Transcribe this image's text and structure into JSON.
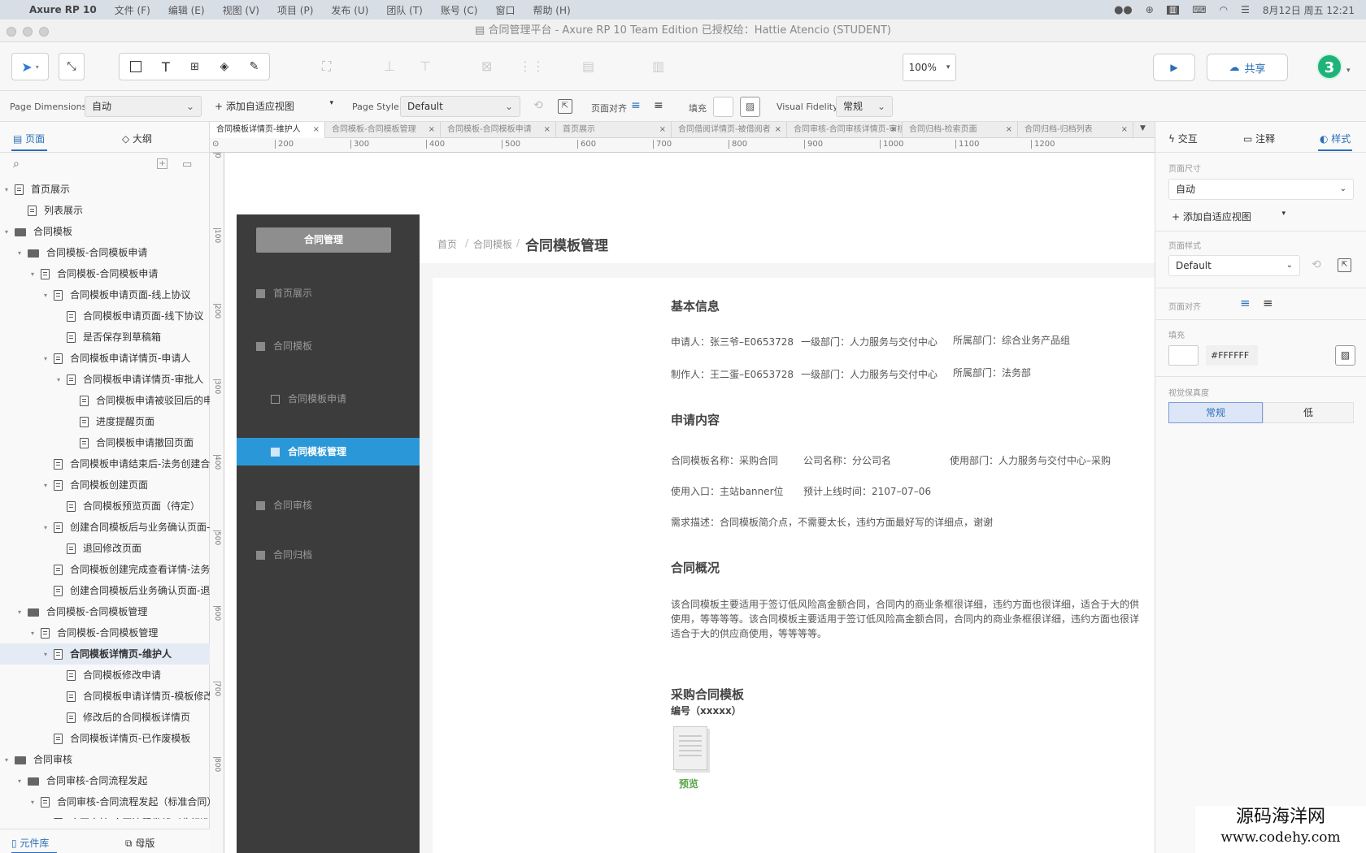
{
  "menubar": {
    "items": [
      "Axure RP 10",
      "文件 (F)",
      "编辑 (E)",
      "视图 (V)",
      "项目 (P)",
      "发布 (U)",
      "团队 (T)",
      "账号 (C)",
      "窗口",
      "帮助 (H)"
    ],
    "datetime": "8月12日 周五  12:21"
  },
  "window": {
    "title": "合同管理平台 - Axure RP 10 Team Edition  已授权给：Hattie Atencio (STUDENT)"
  },
  "toolbar": {
    "zoom": "100%",
    "share_label": "共享",
    "user_avatar": "3"
  },
  "props": {
    "page_dimensions_label": "Page Dimensions",
    "page_dimensions_value": "自动",
    "add_adaptive_label": "+ 添加自适应视图",
    "page_style_label": "Page Style",
    "page_style_value": "Default",
    "align_label": "页面对齐",
    "fill_label": "填充",
    "visual_fidelity_label": "Visual Fidelity",
    "visual_fidelity_value": "常规"
  },
  "left_panel": {
    "tab_pages": "页面",
    "tab_outline": "大纲",
    "bottom_library": "元件库",
    "bottom_masters": "母版",
    "tree": [
      {
        "label": "首页展示",
        "indent": 0,
        "type": "page",
        "arrow": "▾"
      },
      {
        "label": "列表展示",
        "indent": 1,
        "type": "page",
        "arrow": ""
      },
      {
        "label": "合同模板",
        "indent": 0,
        "type": "folder",
        "arrow": "▾"
      },
      {
        "label": "合同模板-合同模板申请",
        "indent": 1,
        "type": "folder",
        "arrow": "▾"
      },
      {
        "label": "合同模板-合同模板申请",
        "indent": 2,
        "type": "page",
        "arrow": "▾"
      },
      {
        "label": "合同模板申请页面-线上协议",
        "indent": 3,
        "type": "page",
        "arrow": "▾"
      },
      {
        "label": "合同模板申请页面-线下协议",
        "indent": 4,
        "type": "page",
        "arrow": ""
      },
      {
        "label": "是否保存到草稿箱",
        "indent": 4,
        "type": "page",
        "arrow": ""
      },
      {
        "label": "合同模板申请详情页-申请人",
        "indent": 3,
        "type": "page",
        "arrow": "▾"
      },
      {
        "label": "合同模板申请详情页-审批人",
        "indent": 4,
        "type": "page",
        "arrow": "▾"
      },
      {
        "label": "合同模板申请被驳回后的申",
        "indent": 5,
        "type": "page",
        "arrow": ""
      },
      {
        "label": "进度提醒页面",
        "indent": 5,
        "type": "page",
        "arrow": ""
      },
      {
        "label": "合同模板申请撤回页面",
        "indent": 5,
        "type": "page",
        "arrow": ""
      },
      {
        "label": "合同模板申请结束后-法务创建合同",
        "indent": 3,
        "type": "page",
        "arrow": ""
      },
      {
        "label": "合同模板创建页面",
        "indent": 3,
        "type": "page",
        "arrow": "▾"
      },
      {
        "label": "合同模板预览页面（待定）",
        "indent": 4,
        "type": "page",
        "arrow": ""
      },
      {
        "label": "创建合同模板后与业务确认页面-业",
        "indent": 3,
        "type": "page",
        "arrow": "▾"
      },
      {
        "label": "退回修改页面",
        "indent": 4,
        "type": "page",
        "arrow": ""
      },
      {
        "label": "合同模板创建完成查看详情-法务人",
        "indent": 3,
        "type": "page",
        "arrow": ""
      },
      {
        "label": "创建合同模板后业务确认页面-退回",
        "indent": 3,
        "type": "page",
        "arrow": ""
      },
      {
        "label": "合同模板-合同模板管理",
        "indent": 1,
        "type": "folder",
        "arrow": "▾"
      },
      {
        "label": "合同模板-合同模板管理",
        "indent": 2,
        "type": "page",
        "arrow": "▾"
      },
      {
        "label": "合同模板详情页-维护人",
        "indent": 3,
        "type": "page",
        "arrow": "▾",
        "selected": true
      },
      {
        "label": "合同模板修改申请",
        "indent": 4,
        "type": "page",
        "arrow": ""
      },
      {
        "label": "合同模板申请详情页-模板修改",
        "indent": 4,
        "type": "page",
        "arrow": ""
      },
      {
        "label": "修改后的合同模板详情页",
        "indent": 4,
        "type": "page",
        "arrow": ""
      },
      {
        "label": "合同模板详情页-已作废模板",
        "indent": 3,
        "type": "page",
        "arrow": ""
      },
      {
        "label": "合同审核",
        "indent": 0,
        "type": "folder",
        "arrow": "▾"
      },
      {
        "label": "合同审核-合同流程发起",
        "indent": 1,
        "type": "folder",
        "arrow": "▾"
      },
      {
        "label": "合同审核-合同流程发起（标准合同）",
        "indent": 2,
        "type": "page",
        "arrow": "▾"
      },
      {
        "label": "合同审核-合同流程发起（非标准",
        "indent": 3,
        "type": "page",
        "arrow": ""
      }
    ]
  },
  "doc_tabs": [
    {
      "label": "合同模板详情页-维护人",
      "active": true
    },
    {
      "label": "合同模板-合同模板管理",
      "active": false
    },
    {
      "label": "合同模板-合同模板申请",
      "active": false
    },
    {
      "label": "首页展示",
      "active": false
    },
    {
      "label": "合同借阅详情页-被借阅者",
      "active": false
    },
    {
      "label": "合同审核-合同审核详情页-审核人",
      "active": false
    },
    {
      "label": "合同归档-检索页面",
      "active": false
    },
    {
      "label": "合同归档-归档列表",
      "active": false
    }
  ],
  "ruler_h": [
    "200",
    "300",
    "400",
    "500",
    "600",
    "700",
    "800",
    "900",
    "1000",
    "1100",
    "1200"
  ],
  "ruler_v": [
    "0",
    "100",
    "200",
    "300",
    "400",
    "500",
    "600",
    "700",
    "800"
  ],
  "prototype": {
    "top_button": "合同管理",
    "side_items": [
      {
        "label": "首页展示",
        "sub": false,
        "active": false
      },
      {
        "label": "合同模板",
        "sub": false,
        "active": false
      },
      {
        "label": "合同模板申请",
        "sub": true,
        "active": false
      },
      {
        "label": "合同模板管理",
        "sub": true,
        "active": true
      },
      {
        "label": "合同审核",
        "sub": false,
        "active": false
      },
      {
        "label": "合同归档",
        "sub": false,
        "active": false
      }
    ],
    "breadcrumb": {
      "home": "首页",
      "parent": "合同模板",
      "sep": "/",
      "current": "合同模板管理"
    },
    "basic_title": "基本信息",
    "applicant": "申请人：张三爷–E0653728",
    "dept1": "一级部门：人力服务与交付中心",
    "owner_dept1": "所属部门：综合业务产品组",
    "maker": "制作人：王二蛋–E0653728",
    "dept2": "一级部门：人力服务与交付中心",
    "owner_dept2": "所属部门：法务部",
    "apply_title": "申请内容",
    "tpl_name": "合同模板名称：采购合同",
    "company": "公司名称：分公司名",
    "use_dept": "使用部门：人力服务与交付中心–采购",
    "entry": "使用入口：主站banner位",
    "launch": "预计上线时间：2107–07–06",
    "desc": "需求描述：合同模板简介点，不需要太长，违约方面最好写的详细点，谢谢",
    "overview_title": "合同概况",
    "overview_l1": "该合同模板主要适用于签订低风险高金额合同，合同内的商业条框很详细，违约方面也很详细，适合于大的供",
    "overview_l2": "使用，等等等等。该合同模板主要适用于签订低风险高金额合同，合同内的商业条框很详细，违约方面也很详",
    "overview_l3": "适合于大的供应商使用，等等等等。",
    "purchase_title": "采购合同模板",
    "number": "编号（xxxxx）",
    "preview": "预览"
  },
  "right_panel": {
    "tab_interact": "交互",
    "tab_notes": "注释",
    "tab_style": "样式",
    "page_size_label": "页面尺寸",
    "page_size_value": "自动",
    "add_adaptive": "+ 添加自适应视图",
    "page_style_label": "页面样式",
    "page_style_value": "Default",
    "align_label": "页面对齐",
    "fill_label": "填充",
    "fill_value": "#FFFFFF",
    "fidelity_label": "视觉保真度",
    "fidelity_normal": "常规",
    "fidelity_low": "低"
  },
  "watermark": {
    "line1": "源码海洋网",
    "line2": "www.codehy.com"
  },
  "colors": {
    "accent": "#2a98d8",
    "sidebar": "#3c3c3c",
    "avatar": "#1fb37a",
    "preview": "#5aa64a"
  }
}
